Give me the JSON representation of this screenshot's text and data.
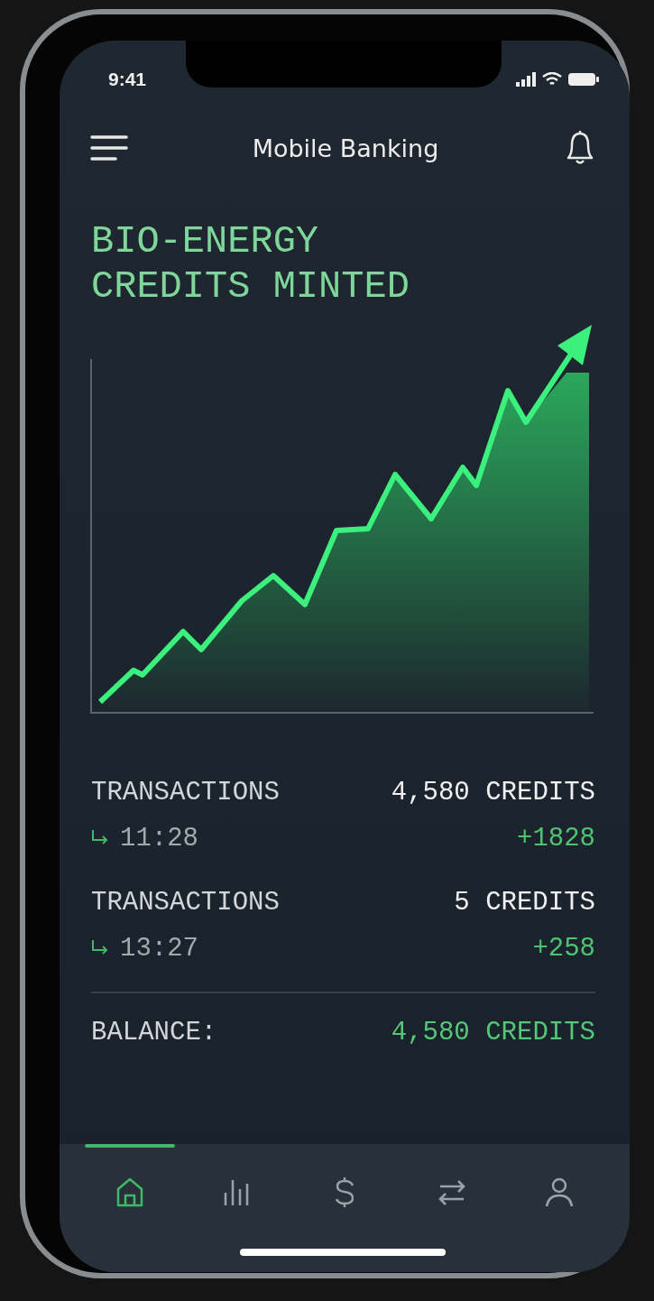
{
  "status_bar": {
    "time": "9:41"
  },
  "header": {
    "title": "Mobile Banking"
  },
  "headline": [
    "BIO-ENERGY",
    "CREDITS MINTED"
  ],
  "transactions": [
    {
      "label": "TRANSACTIONS",
      "amount": "4,580 CREDITS",
      "time": "11:28",
      "change": "+1828"
    },
    {
      "label": "TRANSACTIONS",
      "amount": "5 CREDITS",
      "time": "13:27",
      "change": "+258"
    }
  ],
  "balance": {
    "label": "BALANCE:",
    "value": "4,580 CREDITS"
  },
  "tab_bar": [
    {
      "kind": "home",
      "selected": true
    },
    {
      "kind": "chart",
      "selected": false
    },
    {
      "kind": "dollar",
      "selected": false
    },
    {
      "kind": "transfer",
      "selected": false
    },
    {
      "kind": "profile",
      "selected": false
    }
  ]
}
